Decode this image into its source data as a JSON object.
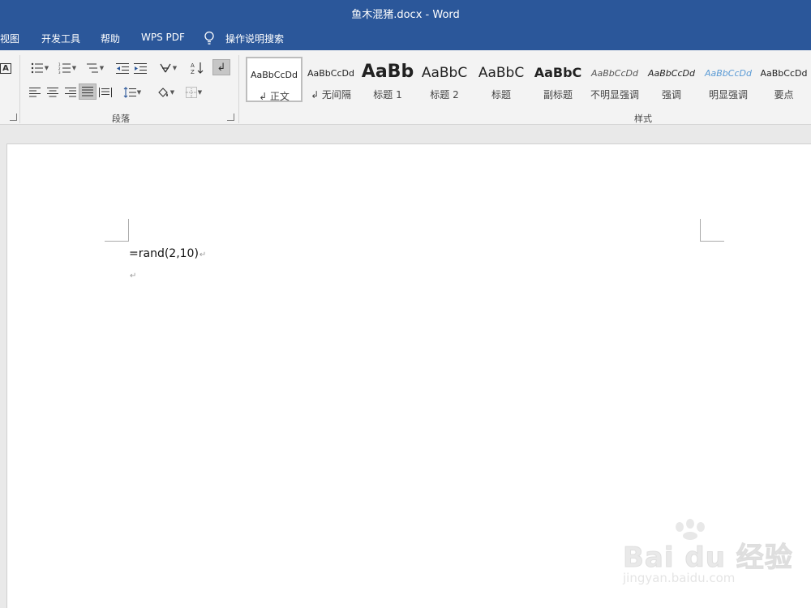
{
  "window": {
    "title": "鱼木混猪.docx  -  Word"
  },
  "menu": {
    "tabs": [
      "视图",
      "开发工具",
      "帮助",
      "WPS PDF"
    ],
    "tell_me": "操作说明搜索"
  },
  "ribbon": {
    "paragraph_group_label": "段落",
    "styles_group_label": "样式",
    "styles": [
      {
        "sample": "AaBbCcDd",
        "name": "↲ 正文"
      },
      {
        "sample": "AaBbCcDd",
        "name": "↲ 无间隔"
      },
      {
        "sample": "AaBb",
        "name": "标题 1"
      },
      {
        "sample": "AaBbC",
        "name": "标题 2"
      },
      {
        "sample": "AaBbC",
        "name": "标题"
      },
      {
        "sample": "AaBbC",
        "name": "副标题"
      },
      {
        "sample": "AaBbCcDd",
        "name": "不明显强调"
      },
      {
        "sample": "AaBbCcDd",
        "name": "强调"
      },
      {
        "sample": "AaBbCcDd",
        "name": "明显强调"
      },
      {
        "sample": "AaBbCcDd",
        "name": "要点"
      }
    ]
  },
  "document": {
    "lines": [
      "=rand(2,10)",
      ""
    ],
    "paragraph_mark": "↵"
  },
  "watermark": {
    "brand": "Bai du 经验",
    "url": "jingyan.baidu.com"
  },
  "colors": {
    "accent": "#2b579a",
    "ribbon_bg": "#f3f3f3",
    "canvas_bg": "#e9e9e9"
  }
}
